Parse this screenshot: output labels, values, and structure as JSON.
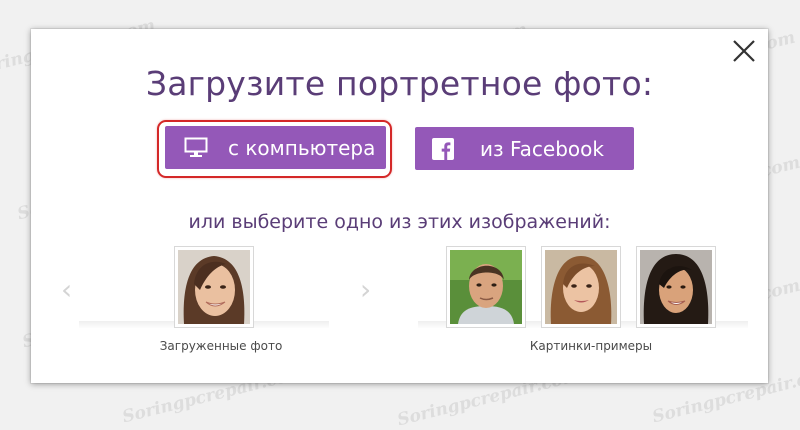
{
  "watermark": "Soringpcrepair.com",
  "dialog": {
    "title": "Загрузите портретное фото:",
    "buttons": {
      "computer_label": "с компьютера",
      "facebook_label": "из Facebook"
    },
    "subtitle": "или выберите одно из этих изображений:",
    "uploaded_caption": "Загруженные фото",
    "samples_caption": "Картинки-примеры",
    "prev_arrow": "‹",
    "next_arrow": "›"
  },
  "colors": {
    "button_purple": "#9458b8",
    "title_purple": "#5a3d77",
    "highlight_red": "#d42828"
  },
  "icons": [
    "close-icon",
    "monitor-icon",
    "facebook-icon",
    "chevron-left-icon",
    "chevron-right-icon"
  ]
}
